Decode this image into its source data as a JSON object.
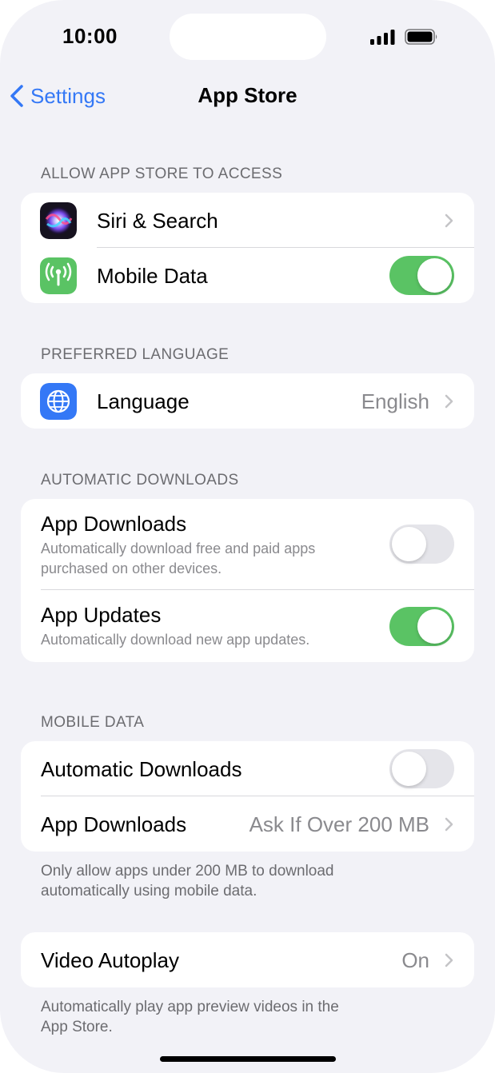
{
  "status_bar": {
    "time": "10:00"
  },
  "nav": {
    "back_label": "Settings",
    "title": "App Store"
  },
  "sections": {
    "access": {
      "header": "ALLOW APP STORE TO ACCESS",
      "siri": {
        "label": "Siri & Search",
        "icon": "siri-icon"
      },
      "mobile_data": {
        "label": "Mobile Data",
        "icon": "antenna-icon",
        "toggle_on": true
      }
    },
    "language": {
      "header": "PREFERRED LANGUAGE",
      "row": {
        "label": "Language",
        "value": "English",
        "icon": "globe-icon"
      }
    },
    "auto_downloads": {
      "header": "AUTOMATIC DOWNLOADS",
      "app_downloads": {
        "title": "App Downloads",
        "subtitle_line1": "Automatically download free and paid apps",
        "subtitle_line2": "purchased on other devices.",
        "toggle_on": false
      },
      "app_updates": {
        "title": "App Updates",
        "subtitle": "Automatically download new app updates.",
        "toggle_on": true
      }
    },
    "mobile_data": {
      "header": "MOBILE DATA",
      "automatic_downloads": {
        "label": "Automatic Downloads",
        "toggle_on": false
      },
      "app_downloads": {
        "label": "App Downloads",
        "value": "Ask If Over 200 MB"
      },
      "footnote_line1": "Only allow apps under 200 MB to download",
      "footnote_line2": "automatically using mobile data."
    },
    "video": {
      "row": {
        "label": "Video Autoplay",
        "value": "On"
      },
      "footnote_line1": "Automatically play app preview videos in the",
      "footnote_line2": "App Store."
    }
  },
  "colors": {
    "accent": "#3478f6",
    "toggle_on": "#5ac364",
    "background": "#f2f2f7",
    "mobile_data_icon": "#5ac364",
    "globe_icon": "#3478f6"
  }
}
